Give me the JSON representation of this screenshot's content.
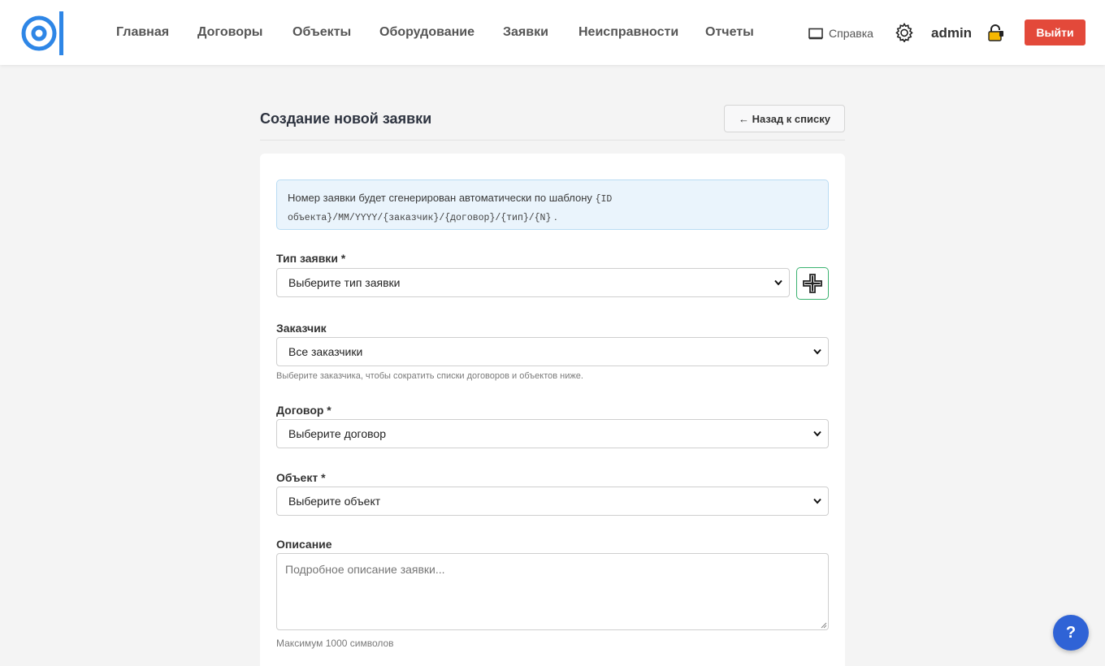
{
  "nav": {
    "items": [
      "Главная",
      "Договоры",
      "Объекты",
      "Оборудование",
      "Заявки",
      "Неисправности",
      "Отчеты"
    ],
    "help_label": "Справка",
    "user_name": "admin",
    "logout_label": "Выйти"
  },
  "page": {
    "title": "Создание новой заявки",
    "back_label": "← Назад к списку"
  },
  "info": {
    "text": "Номер заявки будет сгенерирован автоматически по шаблону",
    "template": "{ID объекта}/MM/YYYY/{заказчик}/{договор}/{тип}/{N}",
    "suffix": "."
  },
  "form": {
    "type": {
      "label": "Тип заявки *",
      "value": "Выберите тип заявки"
    },
    "customer": {
      "label": "Заказчик",
      "value": "Все заказчики",
      "hint": "Выберите заказчика, чтобы сократить списки договоров и объектов ниже."
    },
    "contract": {
      "label": "Договор *",
      "value": "Выберите договор"
    },
    "object": {
      "label": "Объект *",
      "value": "Выберите объект"
    },
    "description": {
      "label": "Описание",
      "placeholder": "Подробное описание заявки...",
      "hint": "Максимум 1000 символов"
    }
  },
  "help_fab": "?",
  "colors": {
    "accent": "#2f63d6",
    "logout": "#e3493a",
    "add_border": "#3cb371",
    "info_bg": "#eaf4fc"
  }
}
